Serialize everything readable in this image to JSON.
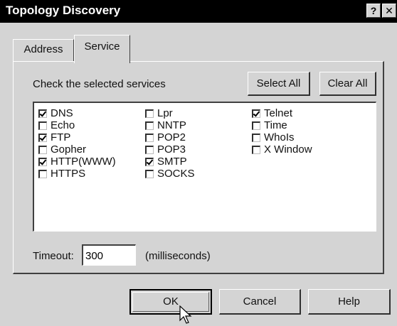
{
  "window": {
    "title": "Topology Discovery",
    "help_glyph": "?",
    "close_glyph": "✕"
  },
  "tabs": [
    {
      "label": "Address",
      "active": false
    },
    {
      "label": "Service",
      "active": true
    }
  ],
  "service_panel": {
    "instruction": "Check the selected services",
    "select_all_label": "Select All",
    "clear_all_label": "Clear All",
    "services": [
      {
        "label": "DNS",
        "checked": true
      },
      {
        "label": "Echo",
        "checked": false
      },
      {
        "label": "FTP",
        "checked": true
      },
      {
        "label": "Gopher",
        "checked": false
      },
      {
        "label": "HTTP(WWW)",
        "checked": true
      },
      {
        "label": "HTTPS",
        "checked": false
      },
      {
        "label": "Lpr",
        "checked": false
      },
      {
        "label": "NNTP",
        "checked": false
      },
      {
        "label": "POP2",
        "checked": false
      },
      {
        "label": "POP3",
        "checked": false
      },
      {
        "label": "SMTP",
        "checked": true
      },
      {
        "label": "SOCKS",
        "checked": false
      },
      {
        "label": "Telnet",
        "checked": true
      },
      {
        "label": "Time",
        "checked": false
      },
      {
        "label": "WhoIs",
        "checked": false
      },
      {
        "label": "X Window",
        "checked": false
      }
    ],
    "timeout_label": "Timeout:",
    "timeout_value": "300",
    "timeout_unit": "(milliseconds)"
  },
  "footer": {
    "ok_label": "OK",
    "cancel_label": "Cancel",
    "help_label": "Help"
  },
  "colors": {
    "titlebar": "#000000",
    "face": "#d4d4d4",
    "list_bg": "#ffffff"
  },
  "icons": {
    "help": "question-mark-icon",
    "close": "close-x-icon",
    "cursor": "mouse-pointer-icon"
  }
}
